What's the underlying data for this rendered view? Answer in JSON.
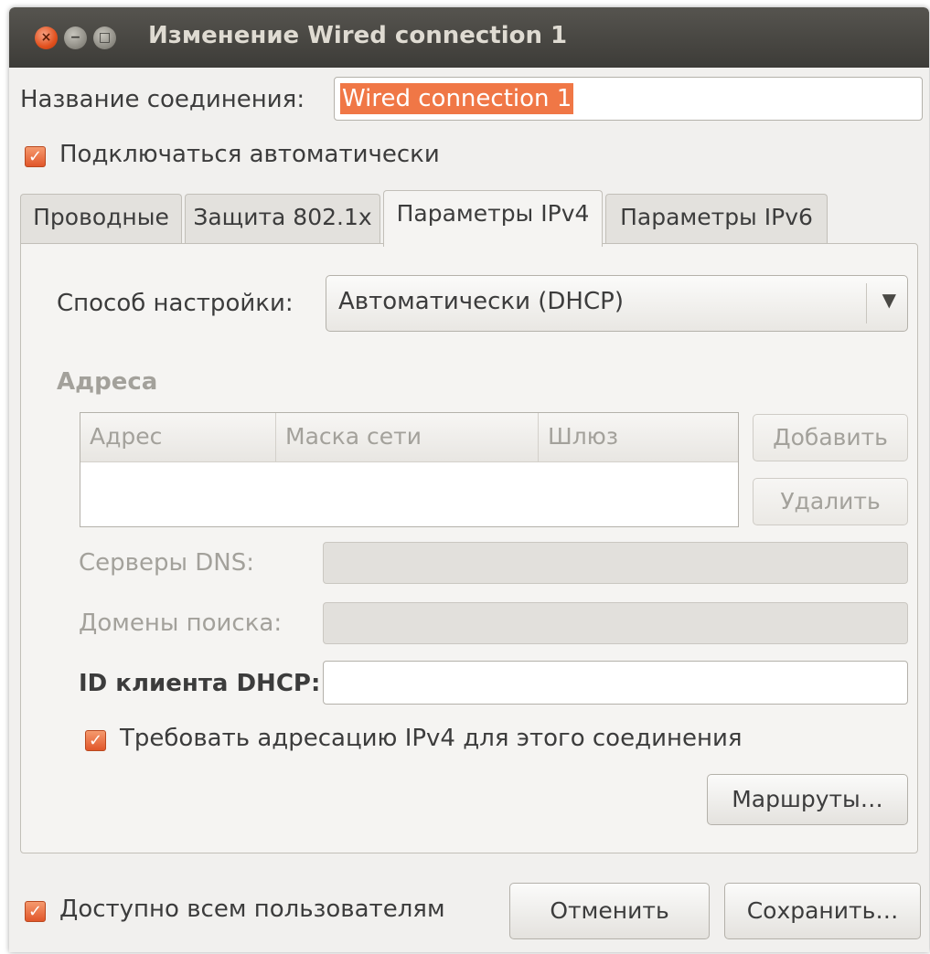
{
  "window": {
    "title": "Изменение Wired connection 1",
    "controls": {
      "close": "×",
      "minimize": "−",
      "maximize": "□"
    }
  },
  "connection_name": {
    "label": "Название соединения:",
    "value": "Wired connection 1"
  },
  "auto_connect": {
    "label": "Подключаться автоматически",
    "checked": true
  },
  "tabs": [
    {
      "label": "Проводные",
      "active": false
    },
    {
      "label": "Защита 802.1x",
      "active": false
    },
    {
      "label": "Параметры IPv4",
      "active": true
    },
    {
      "label": "Параметры IPv6",
      "active": false
    }
  ],
  "ipv4": {
    "method_label": "Способ настройки:",
    "method_value": "Автоматически (DHCP)",
    "addresses_heading": "Адреса",
    "columns": [
      "Адрес",
      "Маска сети",
      "Шлюз"
    ],
    "add_button": "Добавить",
    "delete_button": "Удалить",
    "dns_label": "Серверы DNS:",
    "search_domains_label": "Домены поиска:",
    "dhcp_client_id_label": "ID клиента DHCP:",
    "require_ipv4": {
      "label": "Требовать адресацию IPv4 для этого соединения",
      "checked": true
    },
    "routes_button": "Маршруты…"
  },
  "footer": {
    "all_users": {
      "label": "Доступно всем пользователям",
      "checked": true
    },
    "cancel_button": "Отменить",
    "save_button": "Сохранить…"
  },
  "colors": {
    "accent": "#f07746",
    "titlebar": "#3d3c38",
    "window_bg": "#f1f0ee"
  }
}
